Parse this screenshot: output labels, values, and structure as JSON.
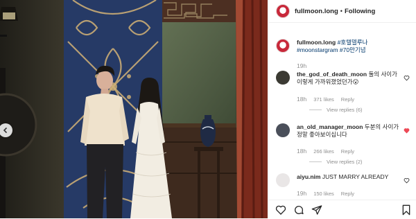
{
  "header": {
    "username": "fullmoon.long",
    "separator": "•",
    "follow_state": "Following"
  },
  "caption": {
    "username": "fullmoon.long",
    "hashtags": [
      "#호텔델루나",
      "#moonstargram",
      "#70만기념"
    ],
    "time": "19h"
  },
  "comments": [
    {
      "username": "the_god_of_death_moon",
      "text": "둘의 사이가 이렇게 가까워졌었던가😮",
      "time": "18h",
      "likes": "371 likes",
      "reply": "Reply",
      "view_replies": "View replies (6)",
      "liked": false
    },
    {
      "username": "an_old_manager_moon",
      "text": "두분의 사이가 정말 좋아보이십니다",
      "time": "18h",
      "likes": "266 likes",
      "reply": "Reply",
      "view_replies": "View replies (2)",
      "liked": true
    },
    {
      "username": "aiyu.nim",
      "text": "JUST MARRY ALREADY",
      "time": "19h",
      "likes": "150 likes",
      "reply": "Reply",
      "liked": false
    }
  ],
  "icons": {
    "like": "heart-icon",
    "comment": "comment-icon",
    "share": "share-icon",
    "save": "bookmark-icon",
    "photo_nav": "chevron-left-icon"
  },
  "colors": {
    "liked_heart": "#ed4956",
    "hashtag": "#00376b",
    "meta_text": "#8e8e8e"
  }
}
